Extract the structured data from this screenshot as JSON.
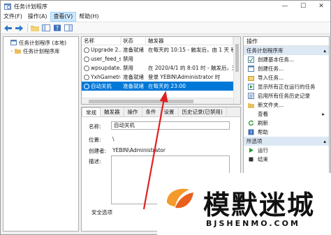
{
  "window": {
    "title": "任务计划程序",
    "minimize_glyph": "—",
    "maximize_glyph": "☐",
    "close_glyph": "✕"
  },
  "menu": [
    {
      "label": "文件(F)",
      "active": false
    },
    {
      "label": "操作(A)",
      "active": false
    },
    {
      "label": "查看(V)",
      "active": true
    },
    {
      "label": "帮助(H)",
      "active": false
    }
  ],
  "tree": [
    {
      "label": "任务计划程序 (本地)",
      "arrow": ""
    },
    {
      "label": "任务计划程序库",
      "arrow": "›"
    }
  ],
  "task_table": {
    "headers": [
      "名称",
      "状态",
      "触发器"
    ],
    "rows": [
      {
        "name": "Upgrade 2...",
        "status": "准备就绪",
        "trigger": "在每天的 10:15 - 触发后，由 1 天 秒",
        "selected": false
      },
      {
        "name": "user_feed_s...",
        "status": "禁用",
        "trigger": "",
        "selected": false
      },
      {
        "name": "wpsupdate...",
        "status": "禁用",
        "trigger": "在 2020/4/1 的 8:01 时 - 触发后，无",
        "selected": false
      },
      {
        "name": "YxhGametray",
        "status": "准备就绪",
        "trigger": "登录 YEBIN\\Administrator 时",
        "selected": false
      },
      {
        "name": "自动关机",
        "status": "准备就绪",
        "trigger": "在每天的 23:00",
        "selected": true
      }
    ]
  },
  "detail_tabs": [
    "常规",
    "触发器",
    "操作",
    "条件",
    "设置",
    "历史记录(已禁用)"
  ],
  "details": {
    "name_label": "名称:",
    "name_value": "自动关机",
    "location_label": "位置:",
    "location_value": "\\",
    "author_label": "创建者:",
    "author_value": "YEBIN\\Administrator",
    "desc_label": "描述:",
    "security_label": "安全选项"
  },
  "actions_panel": {
    "header": "操作",
    "section1": "任务计划程序库",
    "section1_items": [
      {
        "icon": "create-basic-task-icon",
        "label": "创建基本任务..."
      },
      {
        "icon": "create-task-icon",
        "label": "创建任务..."
      },
      {
        "icon": "import-task-icon",
        "label": "导入任务..."
      },
      {
        "icon": "show-running-tasks-icon",
        "label": "显示所有正在运行的任务"
      },
      {
        "icon": "enable-history-icon",
        "label": "启用所有任务历史记录"
      },
      {
        "icon": "new-folder-icon",
        "label": "新文件夹..."
      },
      {
        "icon": "view-icon",
        "label": "查看",
        "arrow": "▸"
      },
      {
        "icon": "refresh-icon",
        "label": "刷新"
      },
      {
        "icon": "help-icon",
        "label": "帮助"
      }
    ],
    "section2": "所选项",
    "section2_items": [
      {
        "icon": "run-icon",
        "label": "运行"
      },
      {
        "icon": "end-icon",
        "label": "结束"
      }
    ],
    "collapse_glyph": "▴"
  },
  "watermark": {
    "title": "模默迷城",
    "subtitle": "BJSHENMO.COM"
  },
  "colors": {
    "selection": "#0078d7",
    "arrow": "#e02020",
    "section_bg": "#dde8f5"
  }
}
